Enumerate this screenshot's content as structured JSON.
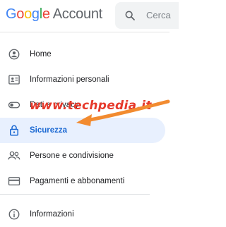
{
  "header": {
    "logo_google": "Google",
    "logo_account": "Account",
    "search_placeholder": "Cerca"
  },
  "nav": {
    "items": [
      {
        "label": "Home",
        "icon": "home-icon"
      },
      {
        "label": "Informazioni personali",
        "icon": "person-card-icon"
      },
      {
        "label": "Dati e privacy",
        "icon": "toggle-icon"
      },
      {
        "label": "Sicurezza",
        "icon": "lock-icon",
        "active": true
      },
      {
        "label": "Persone e condivisione",
        "icon": "people-icon"
      },
      {
        "label": "Pagamenti e abbonamenti",
        "icon": "credit-card-icon"
      }
    ],
    "footer": {
      "label": "Informazioni",
      "icon": "info-icon"
    }
  },
  "overlay": {
    "watermark": "www.techpedia.it"
  },
  "colors": {
    "active_bg": "#e8f0fe",
    "active_text": "#1967d2",
    "watermark": "#e6392b",
    "arrow": "#f28b30"
  }
}
